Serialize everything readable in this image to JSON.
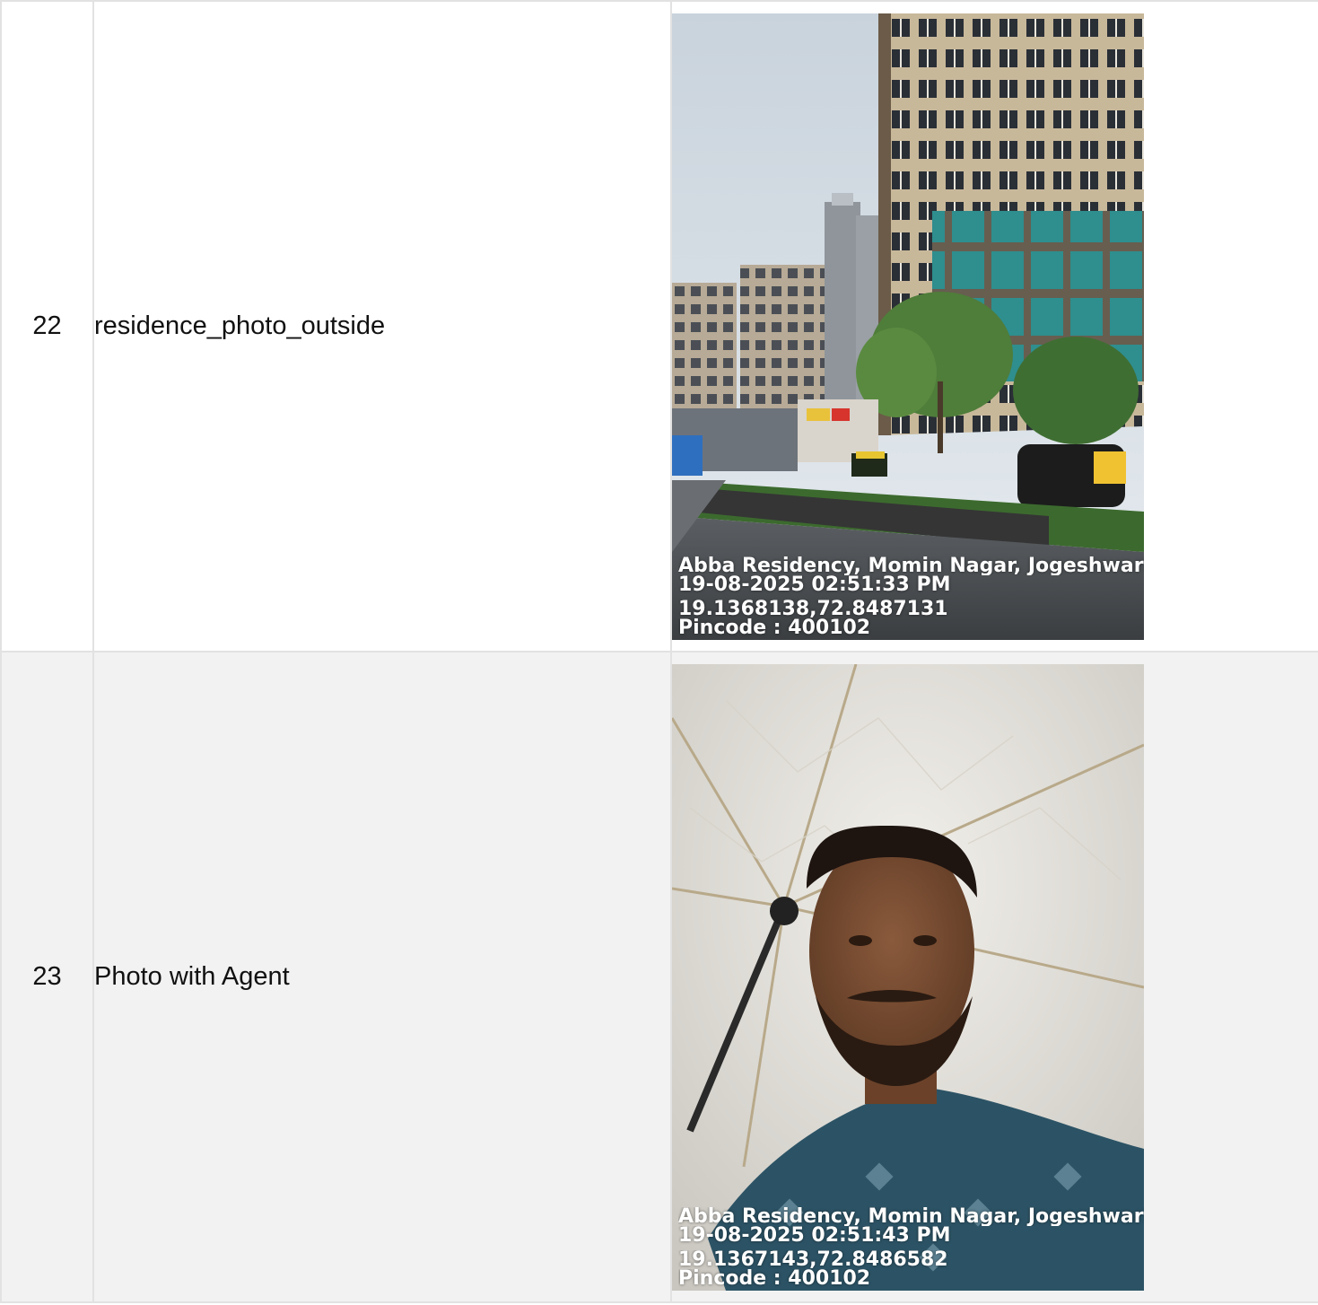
{
  "rows": [
    {
      "number": "22",
      "label": "residence_photo_outside",
      "photo": {
        "subject": "street-view-residential-towers",
        "stamp": {
          "address": "Abba Residency, Momin Nagar, Jogeshwari W",
          "datetime": "19-08-2025 02:51:33 PM",
          "coordinates": "19.1368138,72.8487131",
          "pincode": "Pincode : 400102"
        }
      }
    },
    {
      "number": "23",
      "label": "Photo with Agent",
      "photo": {
        "subject": "agent-selfie-under-umbrella",
        "stamp": {
          "address": "Abba Residency, Momin Nagar, Jogeshwari W",
          "datetime": "19-08-2025 02:51:43 PM",
          "coordinates": "19.1367143,72.8486582",
          "pincode": "Pincode : 400102"
        }
      }
    }
  ],
  "colors": {
    "border": "#e2e2e2",
    "row_alt_background": "#f2f2f2",
    "text": "#111111",
    "stamp_text": "#ffffff"
  }
}
